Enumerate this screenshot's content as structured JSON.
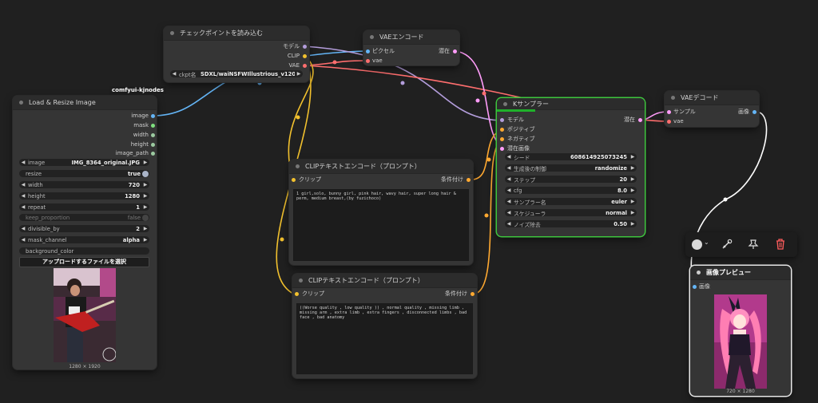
{
  "canvas": {
    "group_label": "comfyui-kjnodes"
  },
  "checkpoint_node": {
    "title": "チェックポイントを読み込む",
    "outputs": [
      "モデル",
      "CLIP",
      "VAE"
    ],
    "widget_name": "ckpt名",
    "widget_value": "SDXL/waiNSFWIllustrious_v120...."
  },
  "vae_encode_node": {
    "title": "VAEエンコード",
    "inputs": [
      "ピクセル",
      "vae"
    ],
    "output": "潜在"
  },
  "load_resize_node": {
    "title": "Load & Resize Image",
    "outputs": [
      "image",
      "mask",
      "width",
      "height",
      "image_path"
    ],
    "widgets": [
      {
        "name": "image",
        "value": "IMG_8364_original.JPG"
      },
      {
        "name": "resize",
        "value": "true"
      },
      {
        "name": "width",
        "value": "720"
      },
      {
        "name": "height",
        "value": "1280"
      },
      {
        "name": "repeat",
        "value": "1"
      },
      {
        "name": "keep_proportion",
        "value": "false"
      },
      {
        "name": "divisible_by",
        "value": "2"
      },
      {
        "name": "mask_channel",
        "value": "alpha"
      },
      {
        "name": "background_color",
        "value": ""
      }
    ],
    "upload_label": "アップロードするファイルを選択",
    "image_size": "1280 × 1920"
  },
  "clip_pos_node": {
    "title": "CLIPテキストエンコード（プロンプト）",
    "input": "クリップ",
    "output": "条件付け",
    "text": "1 girl,solo, bunny girl, pink hair, wavy hair, super long hair & perm, medium breast,(by fuzichoco)"
  },
  "clip_neg_node": {
    "title": "CLIPテキストエンコード（プロンプト）",
    "input": "クリップ",
    "output": "条件付け",
    "text": "((Worse quality , low quality )) , normal quality , missing limb , missing arm , extra limb , extra fingers , disconnected limbs  , bad face , bad anatomy"
  },
  "ksampler_node": {
    "title": "Kサンプラー",
    "inputs": [
      "モデル",
      "ポジティブ",
      "ネガティブ",
      "潜在画像"
    ],
    "output": "潜在",
    "widgets": [
      {
        "name": "シード",
        "value": "608614925073245"
      },
      {
        "name": "生成後の制御",
        "value": "randomize"
      },
      {
        "name": "ステップ",
        "value": "20"
      },
      {
        "name": "cfg",
        "value": "8.0"
      },
      {
        "name": "サンプラー名",
        "value": "euler"
      },
      {
        "name": "スケジューラ",
        "value": "normal"
      },
      {
        "name": "ノイズ除去",
        "value": "0.50"
      }
    ]
  },
  "vae_decode_node": {
    "title": "VAEデコード",
    "inputs": [
      "サンプル",
      "vae"
    ],
    "output": "画像"
  },
  "preview_node": {
    "title": "画像プレビュー",
    "input": "画像",
    "image_size": "720 × 1280"
  },
  "toolbar": {
    "icons": [
      "color-circle-icon",
      "bypass-icon",
      "pin-icon",
      "trash-icon"
    ]
  },
  "colors": {
    "model": "#b39ddb",
    "clip": "#f2c12e",
    "vae": "#ff6e6e",
    "latent": "#ff9cf9",
    "image": "#64b5f6",
    "conditioning": "#ffa931",
    "selected": "#3ec53e"
  }
}
